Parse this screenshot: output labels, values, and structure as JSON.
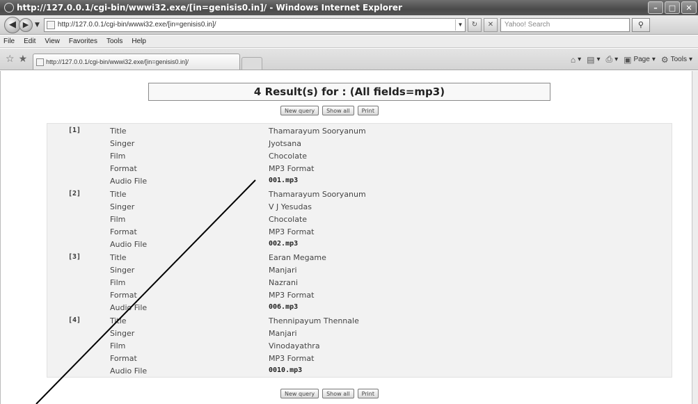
{
  "window": {
    "title": "http://127.0.0.1/cgi-bin/wwwi32.exe/[in=genisis0.in]/ - Windows Internet Explorer",
    "address": "http://127.0.0.1/cgi-bin/wwwi32.exe/[in=genisis0.in]/",
    "search_placeholder": "Yahoo! Search",
    "tab_title": "http://127.0.0.1/cgi-bin/wwwi32.exe/[in=genisis0.in]/"
  },
  "menu": [
    "File",
    "Edit",
    "View",
    "Favorites",
    "Tools",
    "Help"
  ],
  "commands": {
    "page": "Page",
    "tools": "Tools"
  },
  "header": "4 Result(s) for : (All fields=mp3)",
  "buttons": {
    "new_query": "New query",
    "show_all": "Show all",
    "print": "Print"
  },
  "labels": {
    "title": "Title",
    "singer": "Singer",
    "film": "Film",
    "format": "Format",
    "audio_file": "Audio File"
  },
  "records": [
    {
      "num": "[1]",
      "title": "Thamarayum Sooryanum",
      "singer": "Jyotsana",
      "film": "Chocolate",
      "format": "MP3 Format",
      "audio_file": "001.mp3"
    },
    {
      "num": "[2]",
      "title": "Thamarayum Sooryanum",
      "singer": "V J Yesudas",
      "film": "Chocolate",
      "format": "MP3 Format",
      "audio_file": "002.mp3"
    },
    {
      "num": "[3]",
      "title": "Earan Megame",
      "singer": "Manjari",
      "film": "Nazrani",
      "format": "MP3 Format",
      "audio_file": "006.mp3"
    },
    {
      "num": "[4]",
      "title": "Thennipayum Thennale",
      "singer": "Manjari",
      "film": "Vinodayathra",
      "format": "MP3 Format",
      "audio_file": "0010.mp3"
    }
  ]
}
